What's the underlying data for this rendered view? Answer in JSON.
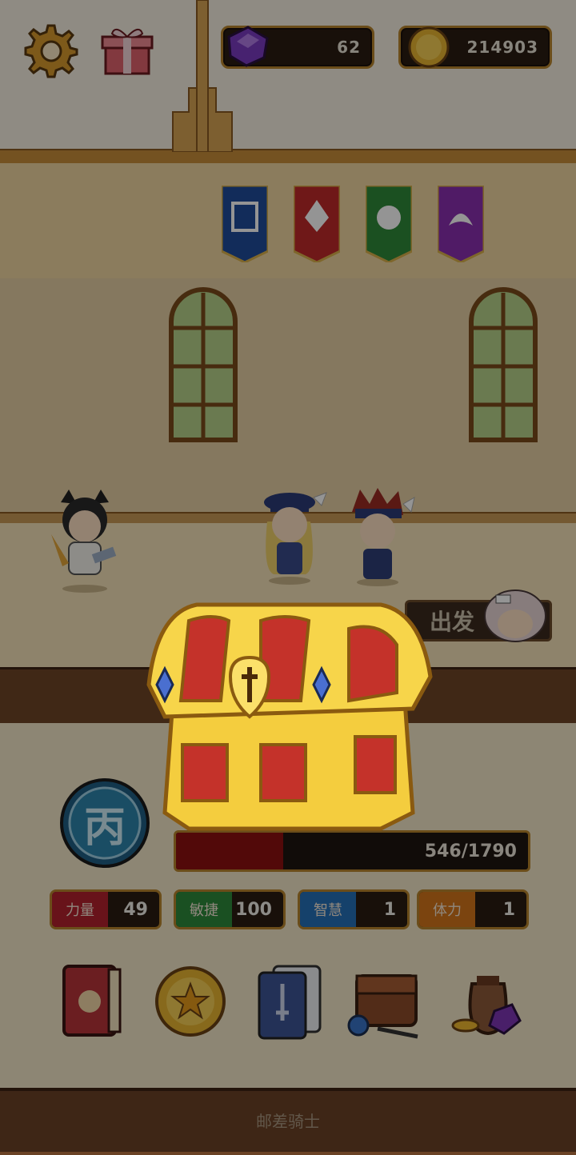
{
  "currency": {
    "gems": "62",
    "gold": "214903"
  },
  "rank": {
    "character": "丙"
  },
  "progress": {
    "text": "546/1790",
    "fraction": 0.305
  },
  "stats": [
    {
      "label": "力量",
      "value": "49",
      "color": "#b3222e"
    },
    {
      "label": "敏捷",
      "value": "100",
      "color": "#2e8a3c"
    },
    {
      "label": "智慧",
      "value": "1",
      "color": "#2570b8"
    },
    {
      "label": "体力",
      "value": "1",
      "color": "#d4761a"
    }
  ],
  "depart_button": {
    "label": "出发"
  },
  "footer": {
    "title": "邮差骑士"
  },
  "icons": [
    "settings-gear-icon",
    "gift-icon",
    "gem-icon",
    "gold-coin-icon",
    "book-icon",
    "star-coin-icon",
    "cards-icon",
    "backpack-icon",
    "treasure-bag-icon",
    "treasure-chest-icon"
  ],
  "colors": {
    "gold_border": "#b8862e",
    "wall": "#e6c98f",
    "floor": "#f1dcae"
  }
}
